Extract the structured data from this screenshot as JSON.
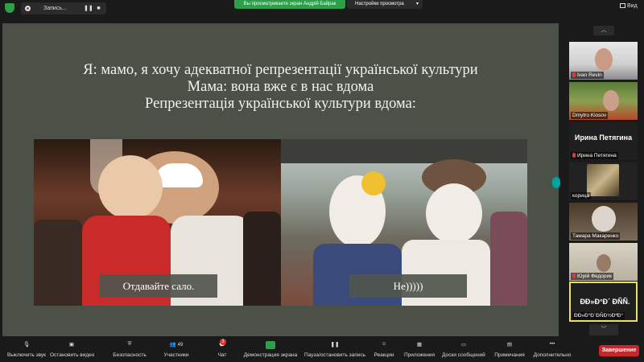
{
  "topbar": {
    "recording_label": "Запись...",
    "share_banner": "Вы просматриваете экран Андрій Байрак",
    "view_options_label": "Настройки просмотра",
    "view_label": "Вид"
  },
  "slide": {
    "lines": [
      "Я: мамо, я хочу адекватної репрезентації української культури",
      "Мама: вона вже є в нас вдома",
      "Репрезентація української культури вдома:"
    ],
    "caption_left": "Отдавайте сало.",
    "caption_right": "Не)))))"
  },
  "participants": [
    {
      "name": "Ivan Revin"
    },
    {
      "name": "Dmytro Kiosov"
    },
    {
      "name": "Ирина Петягина",
      "display": "Ирина Петягина"
    },
    {
      "name": "корица"
    },
    {
      "name": "Тамара Макаренко"
    },
    {
      "name": "Юрій Федорик"
    },
    {
      "name": "ÐÐ»Ð°Ð´ÐÑÐ½ÐªÐ°",
      "display": "ÐÐ»Ð°Ð´ ÐÑÑ."
    }
  ],
  "toolbar": {
    "items": [
      {
        "label": "Выключить звук",
        "icon": "microphone-icon"
      },
      {
        "label": "Остановить видео",
        "icon": "video-camera-icon"
      },
      {
        "label": "Безопасность",
        "icon": "shield-icon"
      },
      {
        "label": "Участники",
        "icon": "participants-icon",
        "count": "49"
      },
      {
        "label": "Чат",
        "icon": "chat-icon",
        "badge": "3"
      },
      {
        "label": "Демонстрация экрана",
        "icon": "share-screen-icon"
      },
      {
        "label": "Пауза/остановить запись",
        "icon": "pause-icon"
      },
      {
        "label": "Реакции",
        "icon": "smiley-icon"
      },
      {
        "label": "Приложения",
        "icon": "apps-icon"
      },
      {
        "label": "Доски сообщений",
        "icon": "whiteboard-icon"
      },
      {
        "label": "Примечания",
        "icon": "notes-icon"
      },
      {
        "label": "Дополнительно",
        "icon": "more-icon"
      }
    ],
    "end_label": "Завершение"
  },
  "colors": {
    "slide_bg": "#4b5147",
    "share_green": "#2e9e4a",
    "end_red": "#c9252a",
    "active_border": "#e6e06a"
  }
}
